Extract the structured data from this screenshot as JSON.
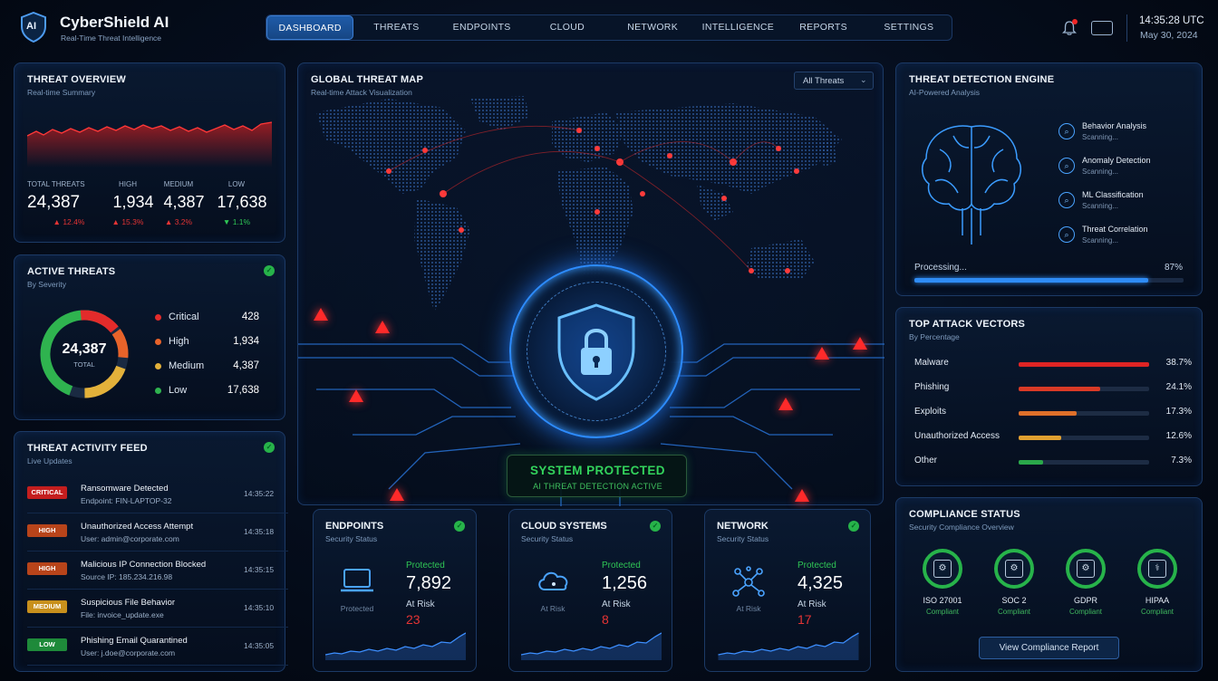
{
  "brand": {
    "name": "CyberShield AI",
    "tagline": "Real-Time Threat Intelligence",
    "logo": "AI"
  },
  "nav": [
    "DASHBOARD",
    "THREATS",
    "ENDPOINTS",
    "CLOUD",
    "NETWORK",
    "INTELLIGENCE",
    "REPORTS",
    "SETTINGS"
  ],
  "clock": {
    "time": "14:35:28 UTC",
    "date": "May 30, 2024"
  },
  "overview": {
    "title": "THREAT OVERVIEW",
    "sub": "Real-time Summary",
    "stats": [
      {
        "label": "TOTAL THREATS",
        "value": "24,387",
        "delta": "▲ 12.4%"
      },
      {
        "label": "HIGH",
        "value": "1,934",
        "delta": "▲ 15.3%"
      },
      {
        "label": "MEDIUM",
        "value": "4,387",
        "delta": "▲ 3.2%"
      },
      {
        "label": "LOW",
        "value": "17,638",
        "delta": "▼ 1.1%"
      }
    ]
  },
  "active": {
    "title": "ACTIVE THREATS",
    "sub": "By Severity",
    "total": "24,387",
    "total_label": "TOTAL",
    "rows": [
      {
        "label": "Critical",
        "value": "428",
        "color": "#e32b2b"
      },
      {
        "label": "High",
        "value": "1,934",
        "color": "#e8632a"
      },
      {
        "label": "Medium",
        "value": "4,387",
        "color": "#e3b13a"
      },
      {
        "label": "Low",
        "value": "17,638",
        "color": "#2fb34f"
      }
    ]
  },
  "feed": {
    "title": "THREAT ACTIVITY FEED",
    "sub": "Live Updates",
    "items": [
      {
        "sev": "CRITICAL",
        "color": "#c41e1e",
        "title": "Ransomware Detected",
        "detail": "Endpoint: FIN-LAPTOP-32",
        "time": "14:35:22"
      },
      {
        "sev": "HIGH",
        "color": "#b8441a",
        "title": "Unauthorized Access Attempt",
        "detail": "User: admin@corporate.com",
        "time": "14:35:18"
      },
      {
        "sev": "HIGH",
        "color": "#b8441a",
        "title": "Malicious IP Connection Blocked",
        "detail": "Source IP: 185.234.216.98",
        "time": "14:35:15"
      },
      {
        "sev": "MEDIUM",
        "color": "#c8901c",
        "title": "Suspicious File Behavior",
        "detail": "File: invoice_update.exe",
        "time": "14:35:10"
      },
      {
        "sev": "LOW",
        "color": "#1e8a3a",
        "title": "Phishing Email Quarantined",
        "detail": "User: j.doe@corporate.com",
        "time": "14:35:05"
      }
    ]
  },
  "map": {
    "title": "GLOBAL THREAT MAP",
    "sub": "Real-time Attack Visualization",
    "filter": "All Threats"
  },
  "status": {
    "title": "SYSTEM PROTECTED",
    "sub": "AI THREAT DETECTION ACTIVE"
  },
  "cards": [
    {
      "title": "ENDPOINTS",
      "sub": "Security Status",
      "prot_label": "Protected",
      "prot": "7,892",
      "risk_label": "At Risk",
      "risk": "23",
      "icon_label": "Protected"
    },
    {
      "title": "CLOUD SYSTEMS",
      "sub": "Security Status",
      "prot_label": "Protected",
      "prot": "1,256",
      "risk_label": "At Risk",
      "risk": "8",
      "icon_label": "At Risk"
    },
    {
      "title": "NETWORK",
      "sub": "Security Status",
      "prot_label": "Protected",
      "prot": "4,325",
      "risk_label": "At Risk",
      "risk": "17",
      "icon_label": "At Risk"
    }
  ],
  "engine": {
    "title": "THREAT DETECTION ENGINE",
    "sub": "AI-Powered Analysis",
    "progress_label": "Processing...",
    "progress_text": "87%",
    "progress": 0.87,
    "items": [
      {
        "title": "Behavior Analysis",
        "status": "Scanning..."
      },
      {
        "title": "Anomaly Detection",
        "status": "Scanning..."
      },
      {
        "title": "ML Classification",
        "status": "Scanning..."
      },
      {
        "title": "Threat Correlation",
        "status": "Scanning..."
      }
    ]
  },
  "vectors": {
    "title": "TOP ATTACK VECTORS",
    "sub": "By Percentage",
    "rows": [
      {
        "label": "Malware",
        "pct": 38.7,
        "text": "38.7%",
        "color": "#e02424"
      },
      {
        "label": "Phishing",
        "pct": 24.1,
        "text": "24.1%",
        "color": "#d93a26"
      },
      {
        "label": "Exploits",
        "pct": 17.3,
        "text": "17.3%",
        "color": "#e0702a"
      },
      {
        "label": "Unauthorized Access",
        "pct": 12.6,
        "text": "12.6%",
        "color": "#e0a030"
      },
      {
        "label": "Other",
        "pct": 7.3,
        "text": "7.3%",
        "color": "#2aa84a"
      }
    ]
  },
  "compliance": {
    "title": "COMPLIANCE STATUS",
    "sub": "Security Compliance Overview",
    "button": "View Compliance Report",
    "items": [
      {
        "name": "ISO 27001",
        "status": "Compliant"
      },
      {
        "name": "SOC 2",
        "status": "Compliant"
      },
      {
        "name": "GDPR",
        "status": "Compliant"
      },
      {
        "name": "HIPAA",
        "status": "Compliant"
      }
    ]
  }
}
